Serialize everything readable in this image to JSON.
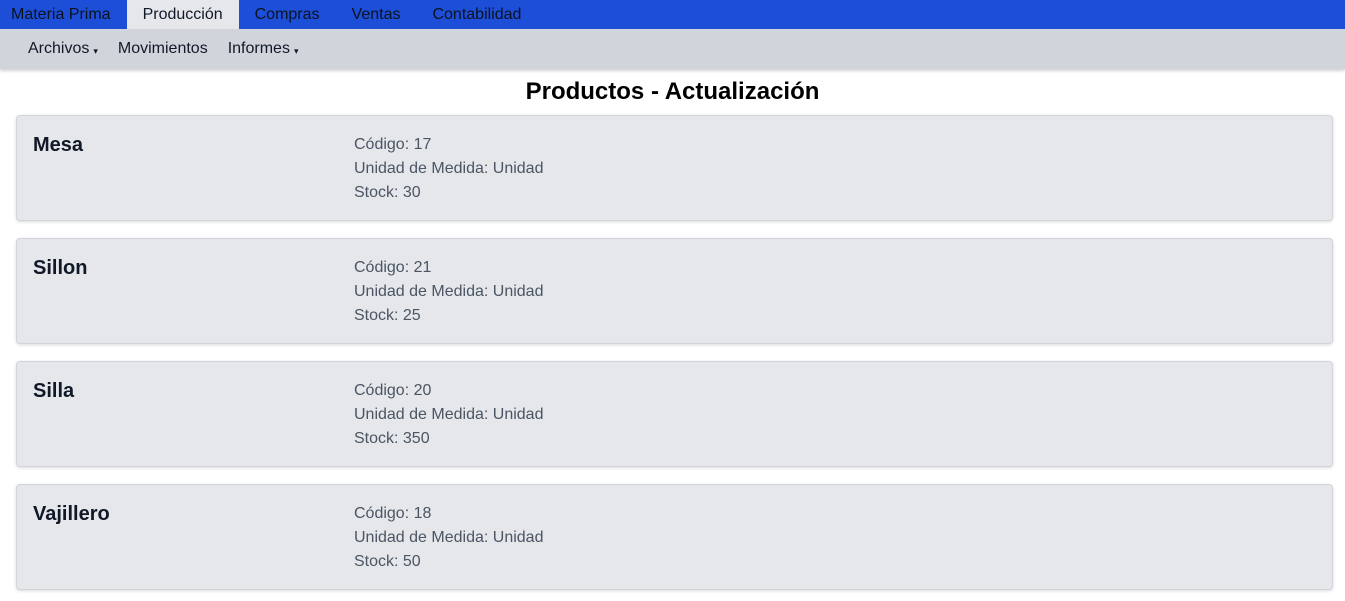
{
  "topnav": {
    "tabs": [
      {
        "label": "Materia Prima"
      },
      {
        "label": "Producción"
      },
      {
        "label": "Compras"
      },
      {
        "label": "Ventas"
      },
      {
        "label": "Contabilidad"
      }
    ],
    "active": "Producción"
  },
  "subnav": {
    "items": [
      {
        "label": "Archivos",
        "caret": "▾"
      },
      {
        "label": "Movimientos"
      },
      {
        "label": "Informes",
        "caret": "▾"
      }
    ]
  },
  "page": {
    "title": "Productos - Actualización"
  },
  "products": [
    {
      "name": "Mesa",
      "codigo": "Código: 17",
      "unidad": "Unidad de Medida: Unidad",
      "stock": "Stock: 30"
    },
    {
      "name": "Sillon",
      "codigo": "Código: 21",
      "unidad": "Unidad de Medida: Unidad",
      "stock": "Stock: 25"
    },
    {
      "name": "Silla",
      "codigo": "Código: 20",
      "unidad": "Unidad de Medida: Unidad",
      "stock": "Stock: 350"
    },
    {
      "name": "Vajillero",
      "codigo": "Código: 18",
      "unidad": "Unidad de Medida: Unidad",
      "stock": "Stock: 50"
    }
  ],
  "colors": {
    "primary": "#1d4ed8",
    "subnav": "#d1d5db",
    "card": "#e5e7eb"
  }
}
